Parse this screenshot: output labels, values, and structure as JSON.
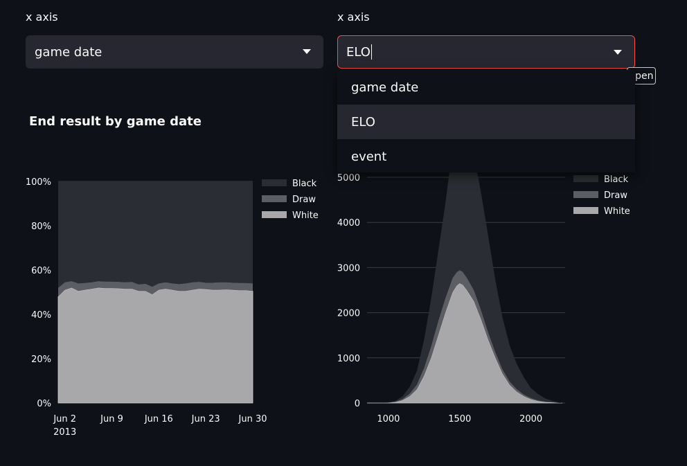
{
  "left_select": {
    "label": "x axis",
    "value": "game date"
  },
  "right_select": {
    "label": "x axis",
    "value": "ELO",
    "tooltip": "open"
  },
  "dropdown": {
    "options": [
      "game date",
      "ELO",
      "event"
    ],
    "selected_index": 1
  },
  "colors": {
    "black": "#2a2d33",
    "draw": "#5c5e63",
    "white": "#a8a8ab",
    "accent": "#ff4b4b"
  },
  "chart_data": [
    {
      "type": "area",
      "stacked": true,
      "normalized": true,
      "title": "End result by game date",
      "x_ticks": [
        "Jun 2",
        "Jun 9",
        "Jun 16",
        "Jun 23",
        "Jun 30"
      ],
      "x_year": "2013",
      "y_ticks": [
        "0%",
        "20%",
        "40%",
        "60%",
        "80%",
        "100%"
      ],
      "legend": [
        "Black",
        "Draw",
        "White"
      ],
      "legend_position": "top-right",
      "x": [
        "Jun 1",
        "Jun 2",
        "Jun 3",
        "Jun 4",
        "Jun 5",
        "Jun 6",
        "Jun 7",
        "Jun 8",
        "Jun 9",
        "Jun 10",
        "Jun 11",
        "Jun 12",
        "Jun 13",
        "Jun 14",
        "Jun 15",
        "Jun 16",
        "Jun 17",
        "Jun 18",
        "Jun 19",
        "Jun 20",
        "Jun 21",
        "Jun 22",
        "Jun 23",
        "Jun 24",
        "Jun 25",
        "Jun 26",
        "Jun 27",
        "Jun 28",
        "Jun 29",
        "Jun 30"
      ],
      "series": [
        {
          "name": "White",
          "values": [
            48,
            51,
            52,
            50.5,
            51,
            51.5,
            52,
            51.8,
            51.8,
            51.7,
            51.5,
            51.5,
            50.5,
            50.5,
            49,
            51,
            51.5,
            51,
            50.5,
            50.5,
            51,
            51.5,
            51.3,
            51,
            51,
            51.2,
            51,
            50.8,
            50.8,
            50.5
          ]
        },
        {
          "name": "Draw",
          "values": [
            4,
            3.5,
            3,
            3.5,
            3.2,
            3,
            3,
            3,
            3,
            3,
            3,
            3.2,
            3,
            3.3,
            3.5,
            3,
            3,
            3,
            3.2,
            3.5,
            3.5,
            3.2,
            3,
            3.3,
            3.5,
            3.3,
            3.3,
            3.4,
            3.4,
            3.5
          ]
        },
        {
          "name": "Black",
          "values": [
            48,
            45.5,
            45,
            46,
            45.8,
            45.5,
            45,
            45.2,
            45.2,
            45.3,
            45.5,
            45.3,
            46.5,
            46.2,
            47.5,
            46,
            45.5,
            46,
            46.3,
            46,
            45.5,
            45.3,
            45.7,
            45.7,
            45.5,
            45.5,
            45.7,
            45.8,
            45.8,
            46
          ]
        }
      ]
    },
    {
      "type": "area",
      "stacked": true,
      "title": "",
      "x_ticks": [
        "1000",
        "1500",
        "2000"
      ],
      "y_ticks": [
        "0",
        "1000",
        "2000",
        "3000",
        "4000",
        "5000"
      ],
      "legend": [
        "Black",
        "Draw",
        "White"
      ],
      "legend_position": "top-right",
      "x": [
        850,
        900,
        950,
        1000,
        1050,
        1100,
        1150,
        1200,
        1250,
        1300,
        1350,
        1400,
        1450,
        1480,
        1500,
        1520,
        1550,
        1600,
        1650,
        1700,
        1750,
        1800,
        1850,
        1900,
        1950,
        2000,
        2050,
        2100,
        2150,
        2200,
        2220
      ],
      "series": [
        {
          "name": "White",
          "values": [
            0,
            0,
            0,
            5,
            20,
            60,
            150,
            300,
            600,
            1000,
            1500,
            2000,
            2450,
            2600,
            2650,
            2620,
            2500,
            2250,
            1850,
            1400,
            1000,
            650,
            400,
            250,
            150,
            80,
            40,
            20,
            10,
            0,
            0
          ]
        },
        {
          "name": "Draw",
          "values": [
            0,
            0,
            0,
            2,
            10,
            30,
            60,
            110,
            180,
            260,
            320,
            330,
            320,
            300,
            290,
            290,
            280,
            250,
            210,
            170,
            130,
            100,
            80,
            60,
            40,
            30,
            20,
            10,
            5,
            0,
            0
          ]
        },
        {
          "name": "Black",
          "values": [
            0,
            0,
            0,
            5,
            20,
            60,
            150,
            300,
            620,
            1050,
            1550,
            2100,
            2900,
            3380,
            3500,
            3440,
            3300,
            3000,
            2600,
            2130,
            1600,
            1150,
            800,
            560,
            380,
            220,
            140,
            70,
            35,
            10,
            0
          ]
        }
      ]
    }
  ]
}
